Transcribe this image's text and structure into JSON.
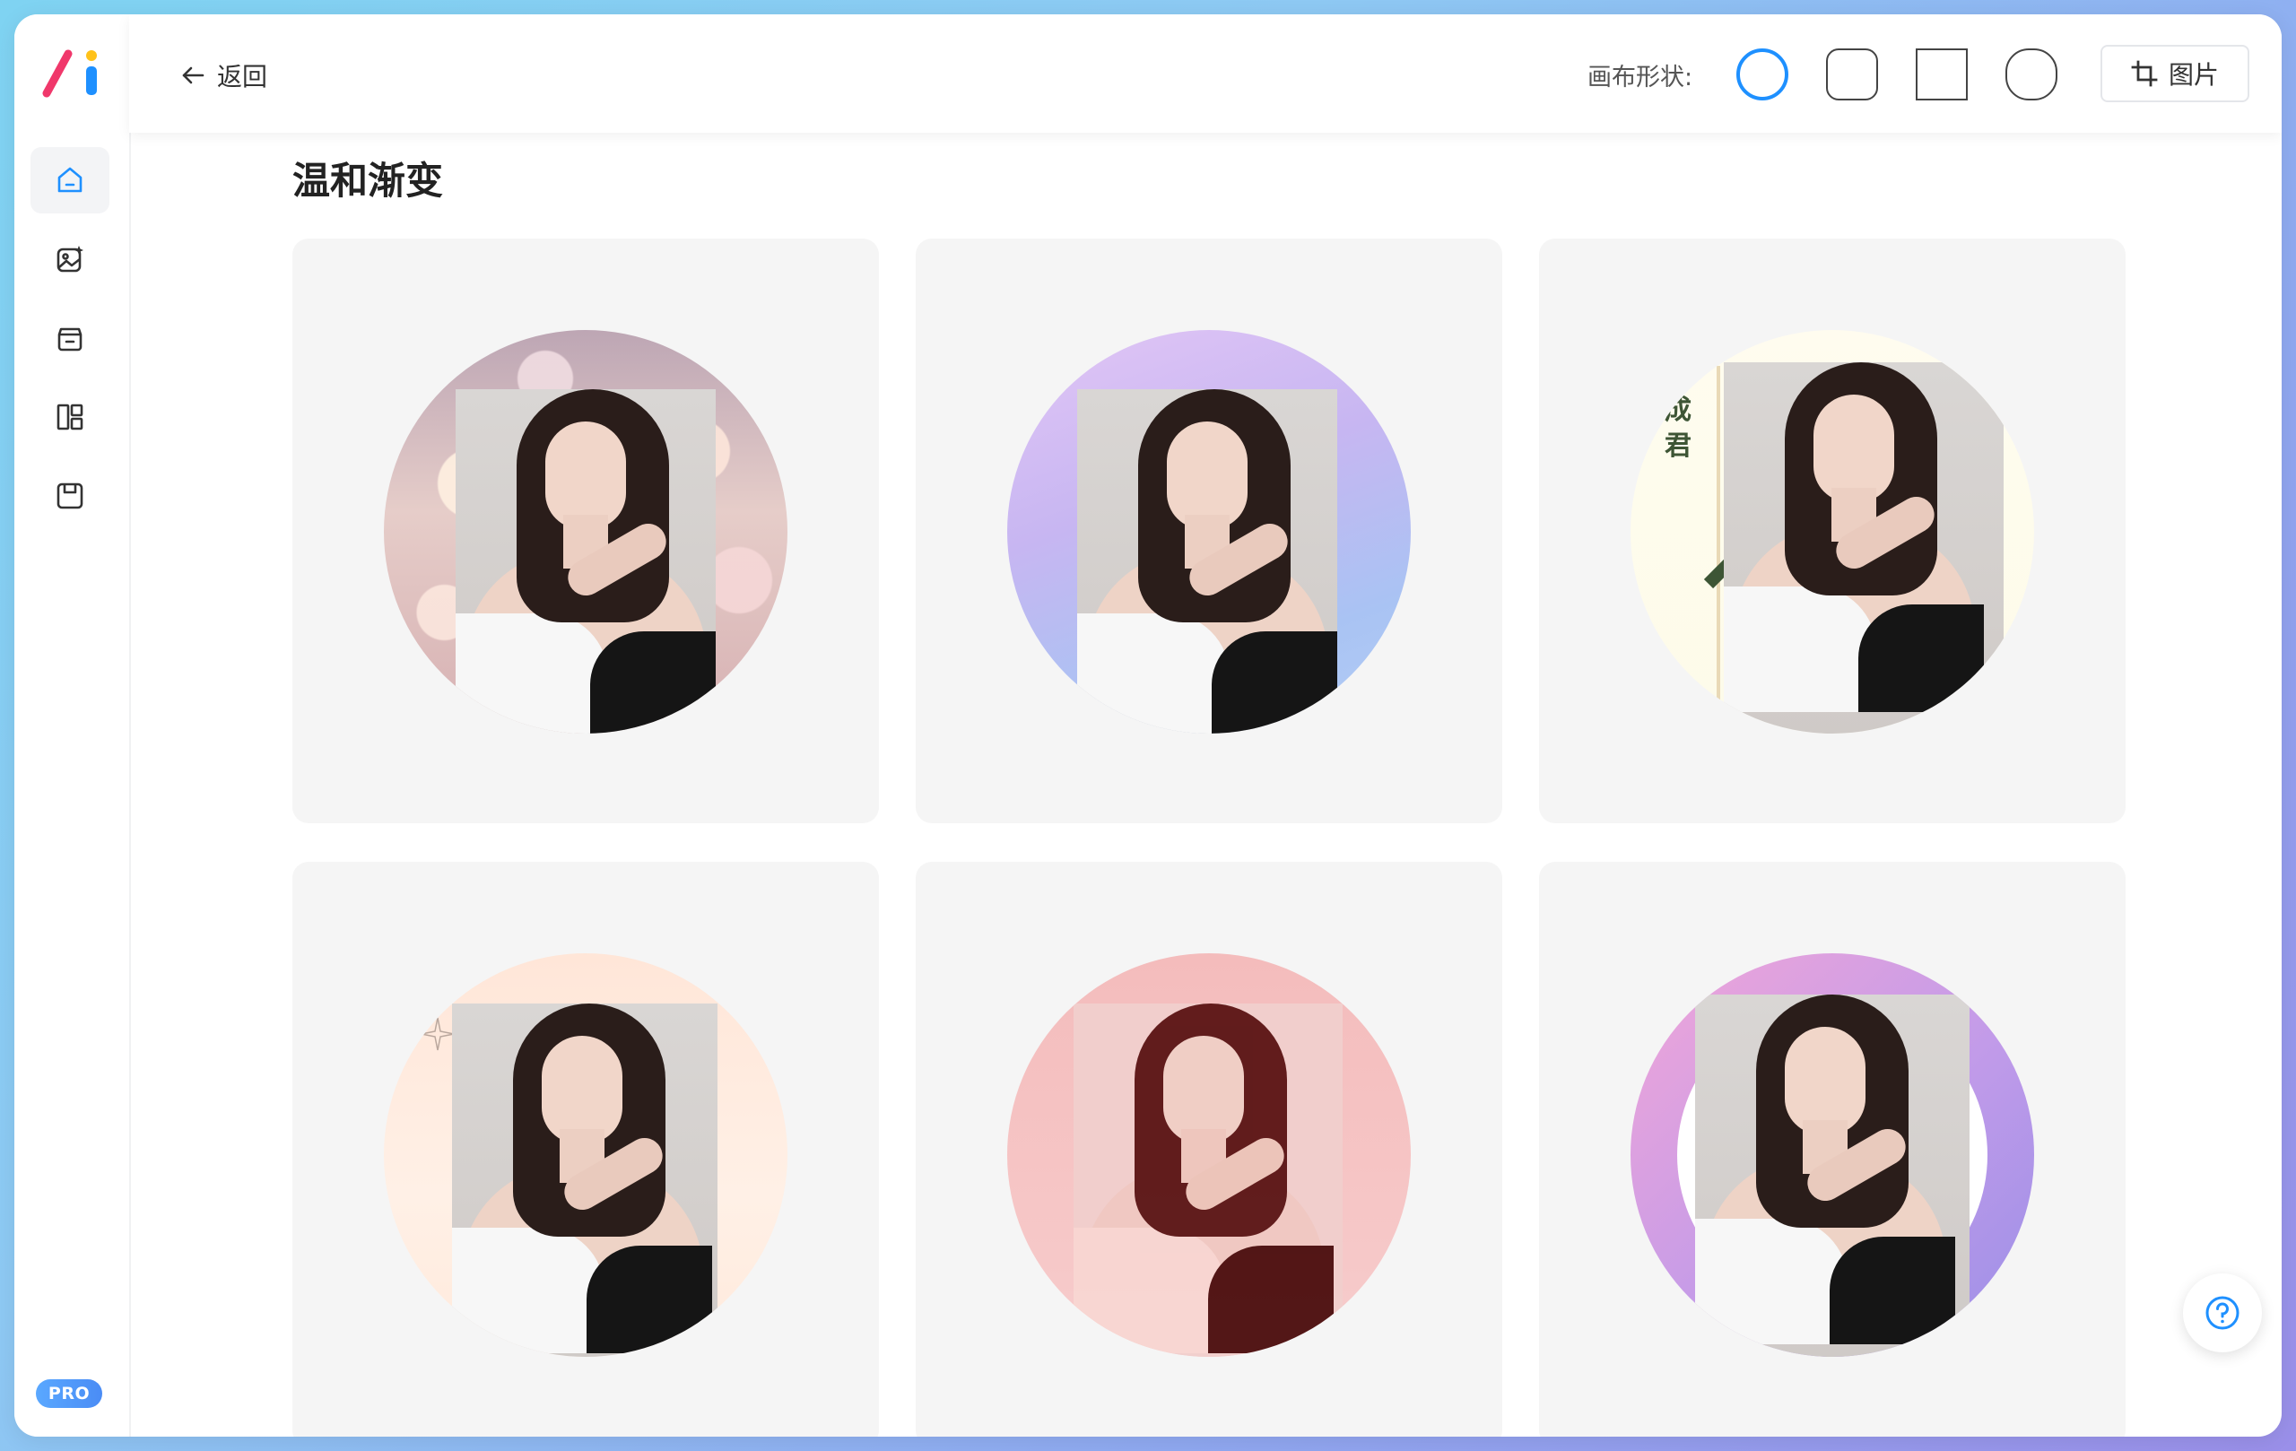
{
  "header": {
    "back_label": "返回",
    "shape_label": "画布形状:",
    "image_button_label": "图片"
  },
  "sidebar": {
    "items": [
      {
        "icon": "home-icon",
        "active": true
      },
      {
        "icon": "image-edit-icon",
        "active": false
      },
      {
        "icon": "box-icon",
        "active": false
      },
      {
        "icon": "layout-icon",
        "active": false
      },
      {
        "icon": "save-icon",
        "active": false
      }
    ],
    "pro_badge": "PRO"
  },
  "section": {
    "title": "温和渐变"
  },
  "templates": [
    {
      "name": "bokeh"
    },
    {
      "name": "lavender-blue"
    },
    {
      "name": "cream-text",
      "deco_text": "成君"
    },
    {
      "name": "peach-sparkle"
    },
    {
      "name": "pink-tint"
    },
    {
      "name": "pink-purple-ring"
    }
  ],
  "colors": {
    "accent": "#1e90ff",
    "logo_pink": "#f0386b",
    "logo_yellow": "#ffc21a",
    "logo_blue": "#1e90ff"
  }
}
